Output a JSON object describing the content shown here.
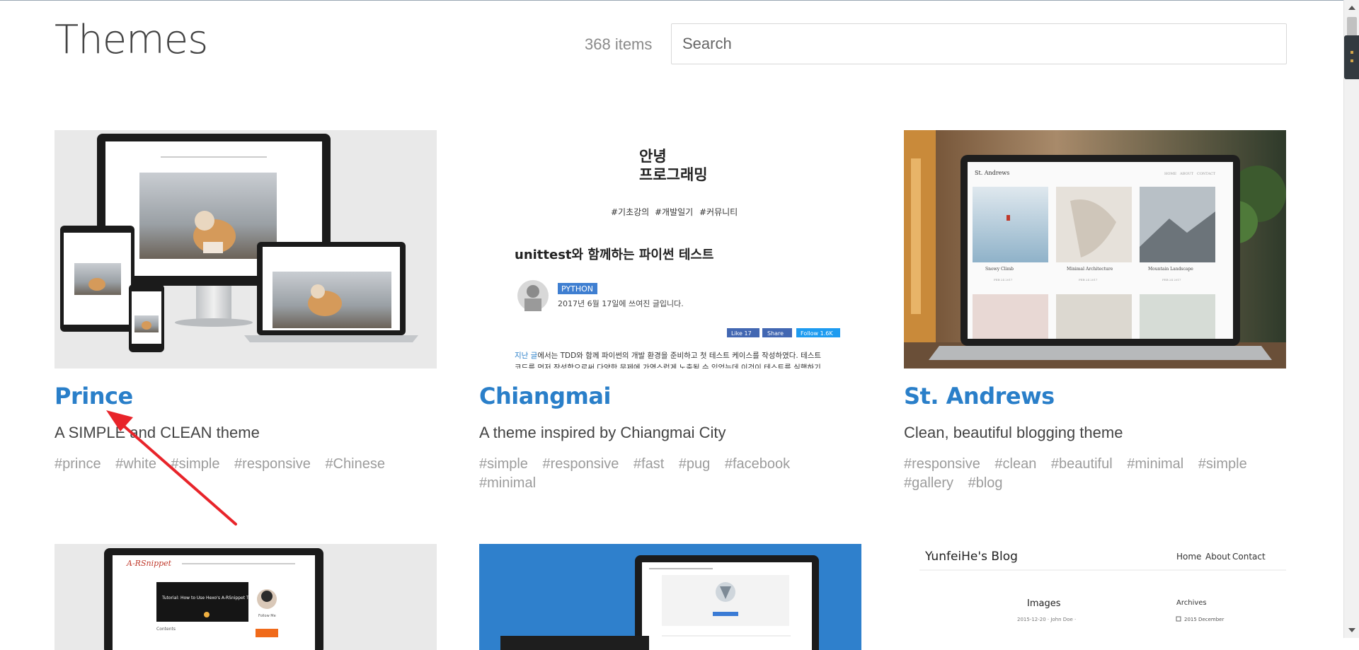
{
  "page": {
    "title": "Themes",
    "count": "368 items",
    "search_placeholder": "Search"
  },
  "themes": [
    {
      "name": "Prince",
      "description": "A SIMPLE and CLEAN theme",
      "tags": [
        "#prince",
        "#white",
        "#simple",
        "#responsive",
        "#Chinese"
      ]
    },
    {
      "name": "Chiangmai",
      "description": "A theme inspired by Chiangmai City",
      "tags": [
        "#simple",
        "#responsive",
        "#fast",
        "#pug",
        "#facebook",
        "#minimal"
      ]
    },
    {
      "name": "St. Andrews",
      "description": "Clean, beautiful blogging theme",
      "tags": [
        "#responsive",
        "#clean",
        "#beautiful",
        "#minimal",
        "#simple",
        "#gallery",
        "#blog"
      ]
    }
  ],
  "previews": {
    "chiangmai": {
      "headline_line1": "안녕",
      "headline_line2": "프로그래밍",
      "hashtags": [
        "#기초강의",
        "#개발일기",
        "#커뮤니티"
      ],
      "post_title": "unittest와 함께하는 파이썬 테스트",
      "category": "PYTHON",
      "date_text": "2017년 6월 17일에 쓰여진 글입니다.",
      "like": "Like 17",
      "share": "Share",
      "follow": "Follow 1.6K",
      "body_link": "지난 글",
      "body_text": "에서는 TDD와 함께 파이썬의 개발 환경을 준비하고 첫 테스트 케이스를 작성하였다. 테스트",
      "body_text2": "코드를 먼저 작성함으로써 다양한 문제에 가역스럽게 노출될 수 있었는데 이것이 테스트를 실행하기"
    },
    "standrews": {
      "site": "St. Andrews",
      "nav": [
        "HOME",
        "ABOUT",
        "CONTACT"
      ],
      "posts": [
        {
          "title": "Snowy Climb",
          "date": "FEB 24 2017"
        },
        {
          "title": "Minimal Architecture",
          "date": "FEB 24 2017"
        },
        {
          "title": "Mountain Landscape",
          "date": "FEB 24 2017"
        }
      ]
    },
    "arsnippet": {
      "logo": "A-RSnippet",
      "post": "Tutorial: How to Use Hexo's A-RSnippet Theme",
      "sidebar": "Follow Me",
      "contents": "Contents"
    },
    "yunfei": {
      "site": "YunfeiHe's Blog",
      "nav": [
        "Home",
        "About",
        "Contact"
      ],
      "post_title": "Images",
      "post_meta": "2015-12-20 · John Doe ·",
      "side_title": "Archives",
      "side_item": "2015 December"
    }
  },
  "colors": {
    "link": "#2a7fc9",
    "tag": "#9c9c9c",
    "annotation_arrow": "#e8242a"
  }
}
